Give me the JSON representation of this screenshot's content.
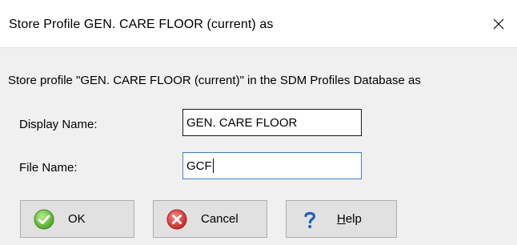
{
  "window": {
    "title": "Store Profile GEN. CARE FLOOR (current) as",
    "close_icon": "close-icon"
  },
  "dialog": {
    "message": "Store profile \"GEN. CARE FLOOR (current)\" in the SDM Profiles Database as",
    "display_name_label": "Display Name:",
    "display_name_value": "GEN. CARE FLOOR",
    "file_name_label": "File Name:",
    "file_name_value": "GCF"
  },
  "buttons": {
    "ok_label": "OK",
    "ok_icon": "check-circle-icon",
    "cancel_label": "Cancel",
    "cancel_icon": "cancel-circle-icon",
    "help_label": "Help",
    "help_icon": "question-mark-icon"
  },
  "colors": {
    "ok_green": "#5cb82e",
    "cancel_red": "#d9373a",
    "help_blue": "#1f5fb8",
    "focus_border": "#3c7fd0"
  }
}
